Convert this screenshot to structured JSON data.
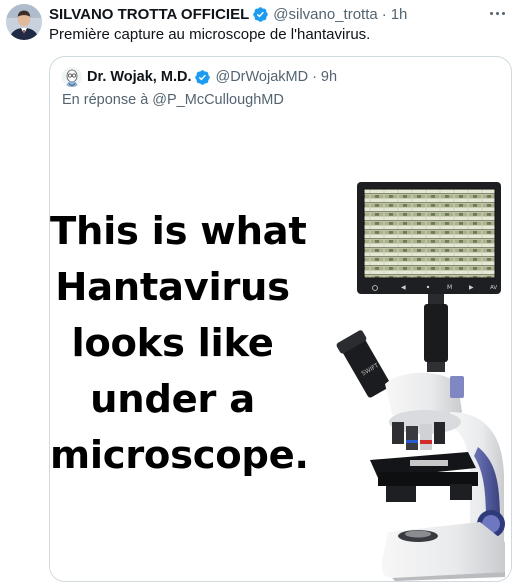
{
  "tweet": {
    "author_name": "SILVANO TROTTA OFFICIEL",
    "handle": "@silvano_trotta",
    "separator": "·",
    "time": "1h",
    "text": "Première capture au microscope de l'hantavirus."
  },
  "quoted_tweet": {
    "author_name": "Dr. Wojak, M.D.",
    "handle": "@DrWojakMD",
    "separator": "·",
    "time": "9h",
    "reply_to": "En réponse à @P_McCulloughMD",
    "image": {
      "caption_lines": [
        "This is what",
        "Hantavirus",
        "looks like",
        "under a",
        "microscope."
      ],
      "screen_buttons": [
        "◀",
        "M",
        "▶",
        "AV"
      ],
      "microscope_brand": "SWIFT"
    }
  },
  "colors": {
    "verified_blue": "#1d9bf0",
    "secondary_text": "#536471",
    "border": "#cfd9de"
  },
  "icons": [
    "verified-badge-icon",
    "more-options-icon"
  ]
}
